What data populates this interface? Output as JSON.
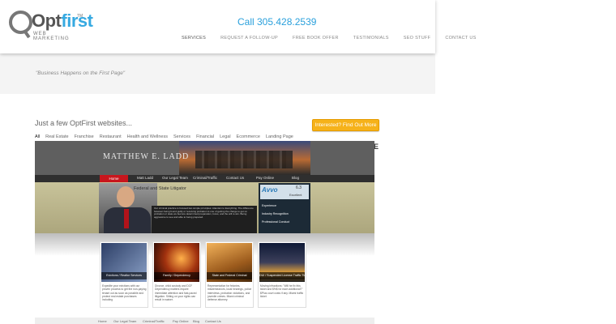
{
  "header": {
    "logo": {
      "prefix": "Opt",
      "accent": "first",
      "tm": "TM",
      "sub": "WEB MARKETING"
    },
    "phone": "Call 305.428.2539",
    "nav": [
      {
        "label": "SERVICES",
        "active": true
      },
      {
        "label": "REQUEST A FOLLOW-UP"
      },
      {
        "label": "FREE BOOK OFFER"
      },
      {
        "label": "TESTIMONIALS"
      },
      {
        "label": "SEO STUFF"
      },
      {
        "label": "CONTACT US"
      }
    ]
  },
  "tagline": "\"Business Happens on the First Page\"",
  "portfolio": {
    "title": "Just a few OptFirst websites...",
    "cta_label": "Interested? Find Out More",
    "filters": [
      "All",
      "Real Estate",
      "Franchise",
      "Restaurant",
      "Health and Wellness",
      "Services",
      "Financial",
      "Legal",
      "Ecommerce",
      "Landing Page"
    ],
    "stray_char": "E"
  },
  "preview": {
    "brand": "MATTHEW E. LADD",
    "nav": [
      "Home",
      "Matt Ladd",
      "Our Legal Team",
      "Criminal/Traffic",
      "Contact Us",
      "Pay Online",
      "Blog"
    ],
    "hero_title": "Federal and State Litigator",
    "hero_text": "Our criminal practice is focused two simple principles: Attention to Everything. The difference between being found guilty or receiving probation is one of getting the charge to get us probation or state we feel are determined preparation, focus, and the will to win. Being aggressive to see and able to being prepared.",
    "avvo": {
      "logo": "Avvo",
      "score": "6.3",
      "rating": "Excellent",
      "rows": [
        "Experience",
        "Industry Recognition",
        "Professional Conduct"
      ]
    },
    "cards": [
      {
        "caption": "Evictions / Realtor Services",
        "text": "Expedite your evictions with our proven process to get the non-paying tenant out as soon as possible and protect real estate purchases including"
      },
      {
        "caption": "Family / Dependency",
        "text": "Divorce, child custody and DCF Dependency matters require immediate attention and fast-paced litigation. Sitting on your rights can result in waiver."
      },
      {
        "caption": "State and Federal Criminal",
        "text": "Representation for felonies, misdemeanors, local hearings, police interviews, probation violations, and juvenile crimes. Miami criminal defense attorney."
      },
      {
        "caption": "DUI / Suspended License Traffic Tickets",
        "text": "Moving infractions: \"Will he fix this ticket and $%$ for each additional?\" $Plus court costs if any. Miami traffic ticket"
      }
    ],
    "bottom_nav": [
      "Home",
      "Our Legal Team",
      "Criminal/Traffic",
      "Pay Online",
      "Blog",
      "Contact Us"
    ]
  },
  "colors": {
    "accent_blue": "#2aa0dc",
    "cta_orange": "#f6b21a",
    "preview_red": "#c8161d"
  }
}
